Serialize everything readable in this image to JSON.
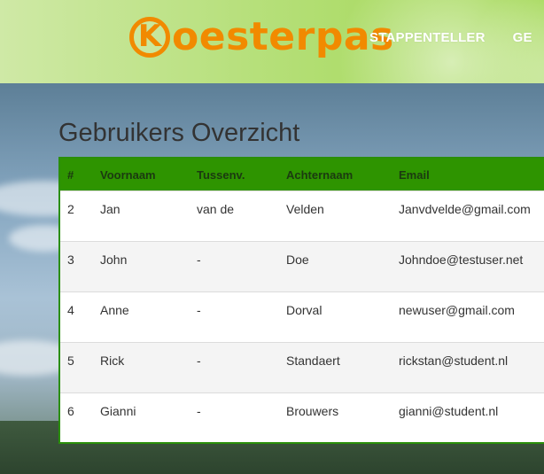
{
  "header": {
    "logo_letter": "K",
    "logo_text": "oesterpas",
    "nav": [
      {
        "label": "STAPPENTELLER"
      },
      {
        "label": "GE"
      }
    ]
  },
  "page": {
    "title": "Gebruikers Overzicht"
  },
  "table": {
    "columns": [
      "#",
      "Voornaam",
      "Tussenv.",
      "Achternaam",
      "Email"
    ],
    "rows": [
      {
        "id": "2",
        "first": "Jan",
        "middle": "van de",
        "last": "Velden",
        "email": "Janvdvelde@gmail.com"
      },
      {
        "id": "3",
        "first": "John",
        "middle": "-",
        "last": "Doe",
        "email": "Johndoe@testuser.net"
      },
      {
        "id": "4",
        "first": "Anne",
        "middle": "-",
        "last": "Dorval",
        "email": "newuser@gmail.com"
      },
      {
        "id": "5",
        "first": "Rick",
        "middle": "-",
        "last": "Standaert",
        "email": "rickstan@student.nl"
      },
      {
        "id": "6",
        "first": "Gianni",
        "middle": "-",
        "last": "Brouwers",
        "email": "gianni@student.nl"
      }
    ]
  },
  "colors": {
    "header_bg": "#b7e07c",
    "logo_orange": "#f18a00",
    "table_header": "#2e9400",
    "table_border": "#2a8f0a"
  }
}
